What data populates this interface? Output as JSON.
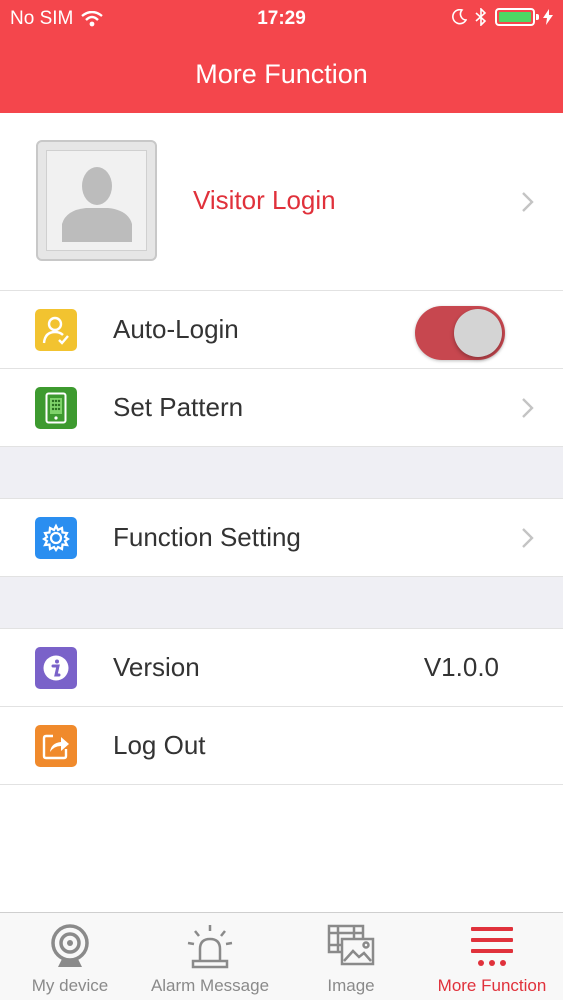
{
  "status_bar": {
    "carrier": "No SIM",
    "time": "17:29",
    "icons": [
      "wifi-icon",
      "moon-icon",
      "bluetooth-icon",
      "battery-icon",
      "charging-icon"
    ],
    "battery_color": "#4cd964"
  },
  "nav": {
    "title": "More Function",
    "color": "#f4464c"
  },
  "profile": {
    "label": "Visitor Login",
    "label_color": "#e0313b",
    "avatar_icon": "user-silhouette-icon"
  },
  "rows": {
    "auto_login": {
      "label": "Auto-Login",
      "icon": "user-check-icon",
      "icon_color": "#f2c330",
      "toggle_on": true
    },
    "set_pattern": {
      "label": "Set Pattern",
      "icon": "phone-keypad-icon",
      "icon_color": "#3d9a2f"
    },
    "function_setting": {
      "label": "Function Setting",
      "icon": "gear-icon",
      "icon_color": "#2a8ef0"
    },
    "version": {
      "label": "Version",
      "value": "V1.0.0",
      "icon": "info-icon",
      "icon_color": "#7a62c9"
    },
    "log_out": {
      "label": "Log Out",
      "icon": "share-out-icon",
      "icon_color": "#f08a2c"
    }
  },
  "tabs": [
    {
      "label": "My device",
      "icon": "webcam-icon",
      "active": false
    },
    {
      "label": "Alarm Message",
      "icon": "alarm-siren-icon",
      "active": false
    },
    {
      "label": "Image",
      "icon": "image-gallery-icon",
      "active": false
    },
    {
      "label": "More Function",
      "icon": "menu-lines-icon",
      "active": true
    }
  ],
  "accent_color": "#e0313b"
}
